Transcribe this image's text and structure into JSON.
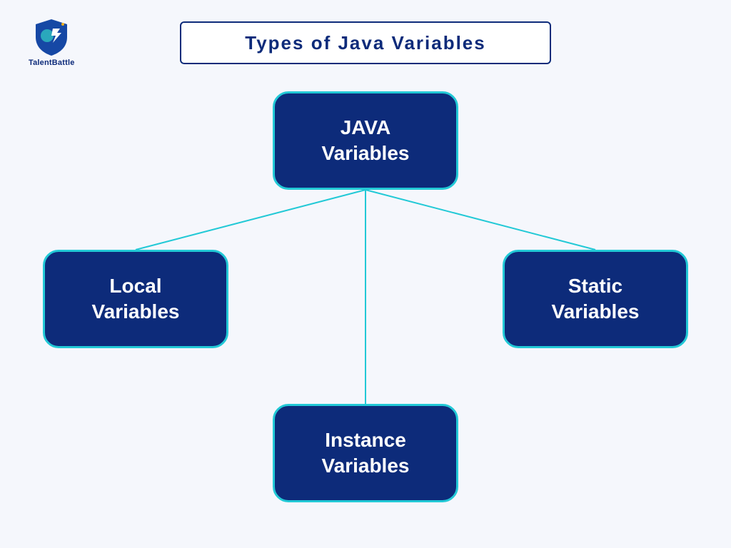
{
  "logo": {
    "name": "TalentBattle"
  },
  "title": "Types of Java Variables",
  "diagram": {
    "root": {
      "line1": "JAVA",
      "line2": "Variables"
    },
    "left": {
      "line1": "Local",
      "line2": "Variables"
    },
    "right": {
      "line1": "Static",
      "line2": "Variables"
    },
    "bottom": {
      "line1": "Instance",
      "line2": "Variables"
    }
  },
  "colors": {
    "background": "#f5f7fc",
    "nodeFill": "#0d2b7a",
    "nodeBorder": "#22c9d6",
    "titleBorder": "#0d2b7a",
    "connector": "#22c9d6"
  }
}
